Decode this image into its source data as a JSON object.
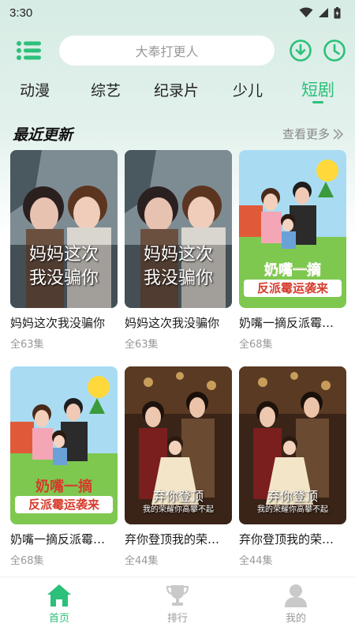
{
  "status_bar": {
    "time": "3:30"
  },
  "header": {
    "search_placeholder": "大奉打更人"
  },
  "tabs": [
    {
      "label": "动漫"
    },
    {
      "label": "综艺"
    },
    {
      "label": "纪录片"
    },
    {
      "label": "少儿"
    },
    {
      "label": "短剧",
      "active": true
    }
  ],
  "section": {
    "title": "最近更新",
    "more": "查看更多"
  },
  "items": [
    {
      "title": "妈妈这次我没骗你",
      "episodes": "全63集",
      "poster_text": [
        "妈妈这次",
        "我没骗你"
      ],
      "poster": "drama-mother"
    },
    {
      "title": "妈妈这次我没骗你",
      "episodes": "全63集",
      "poster_text": [
        "妈妈这次",
        "我没骗你"
      ],
      "poster": "drama-mother"
    },
    {
      "title": "奶嘴一摘反派霉运袭来",
      "episodes": "全68集",
      "poster_text": [
        "奶嘴一摘",
        "反派霉运袭来"
      ],
      "poster": "cartoon-family"
    },
    {
      "title": "奶嘴一摘反派霉运袭来",
      "episodes": "全68集",
      "poster_text": [
        "奶嘴一摘",
        "反派霉运袭来"
      ],
      "poster": "cartoon-family"
    },
    {
      "title": "弃你登顶我的荣耀你高攀不起",
      "episodes": "全44集",
      "poster_text": [
        "弃你登顶",
        "我的荣耀你高攀不起"
      ],
      "poster": "family-portrait"
    },
    {
      "title": "弃你登顶我的荣耀你高攀不起",
      "episodes": "全44集",
      "poster_text": [
        "弃你登顶",
        "我的荣耀你高攀不起"
      ],
      "poster": "family-portrait"
    }
  ],
  "bottom_nav": [
    {
      "label": "首页",
      "icon": "home-icon",
      "active": true
    },
    {
      "label": "排行",
      "icon": "trophy-icon"
    },
    {
      "label": "我的",
      "icon": "user-icon"
    }
  ],
  "colors": {
    "accent": "#2cc07a",
    "header_bg": "#d6ece4"
  }
}
